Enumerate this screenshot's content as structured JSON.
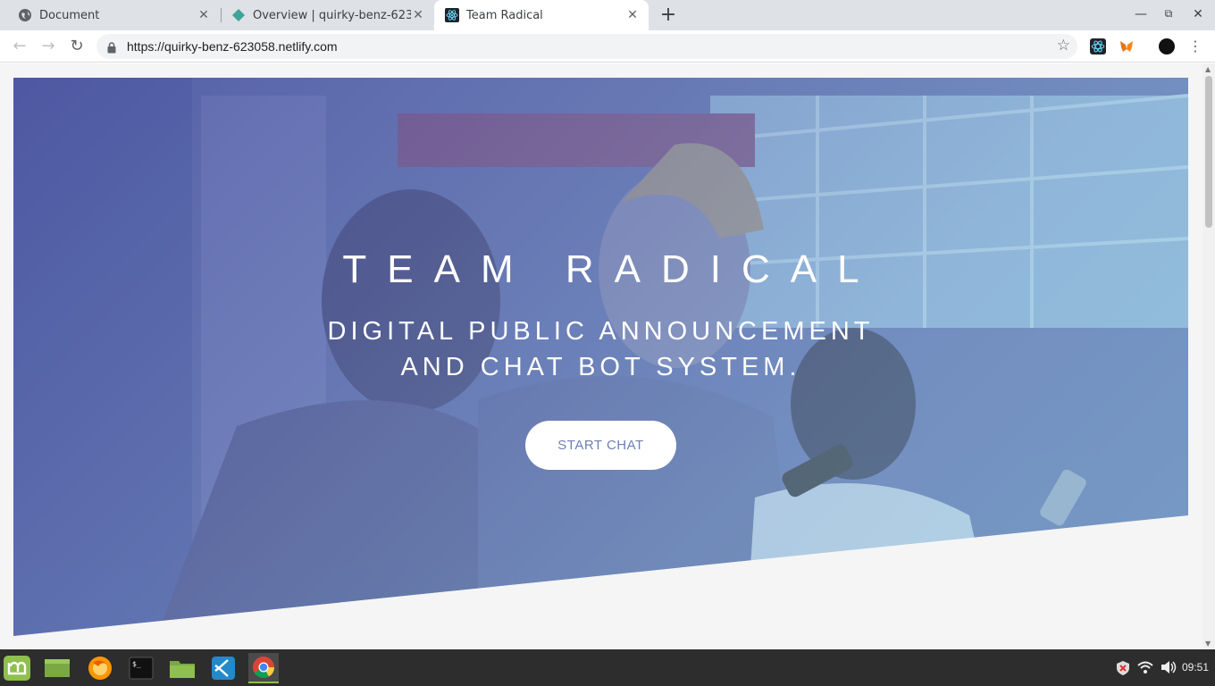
{
  "browser": {
    "tabs": [
      {
        "title": "Document",
        "icon": "globe-icon",
        "active": false
      },
      {
        "title": "Overview | quirky-benz-623058",
        "icon": "netlify-icon",
        "active": false
      },
      {
        "title": "Team Radical",
        "icon": "react-icon",
        "active": true
      }
    ],
    "url": "https://quirky-benz-623058.netlify.com"
  },
  "hero": {
    "title": "TEAM RADICAL",
    "subtitle_line1": "DIGITAL PUBLIC ANNOUNCEMENT",
    "subtitle_line2": "AND CHAT BOT SYSTEM.",
    "cta_label": "START CHAT"
  },
  "taskbar": {
    "apps": [
      "mint-menu-icon",
      "show-desktop-icon",
      "firefox-icon",
      "terminal-icon",
      "files-icon",
      "vscode-icon",
      "chrome-icon"
    ],
    "clock": "09:51"
  },
  "colors": {
    "hero_gradient_start": "#4648a0",
    "hero_gradient_end": "#8cd2e6",
    "cta_text": "#6e7fb6",
    "taskbar_bg": "#2d2d2d"
  }
}
